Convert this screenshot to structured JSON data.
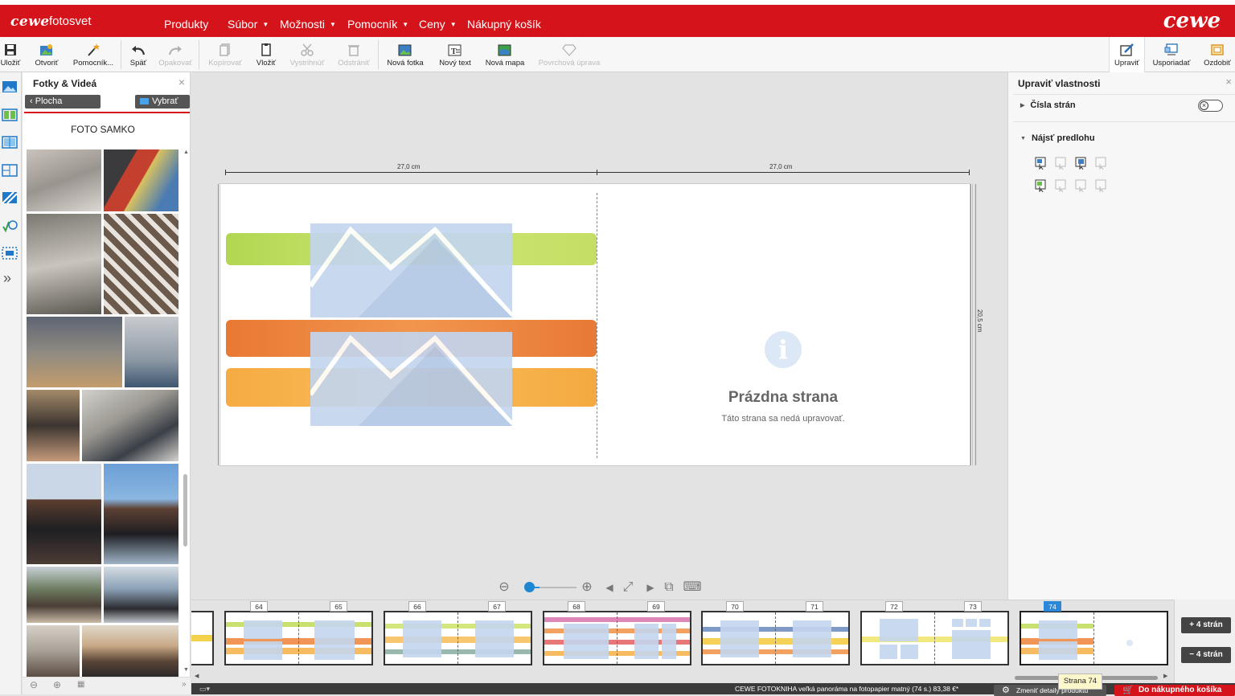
{
  "brand": {
    "logo_left": "cewe",
    "product": "fotosvet",
    "logo_right": "cewe",
    "color": "#d4141a"
  },
  "nav": [
    {
      "label": "Produkty",
      "has_caret": false
    },
    {
      "label": "Súbor",
      "has_caret": true
    },
    {
      "label": "Možnosti",
      "has_caret": true
    },
    {
      "label": "Pomocník",
      "has_caret": true
    },
    {
      "label": "Ceny",
      "has_caret": true
    },
    {
      "label": "Nákupný košík",
      "has_caret": false
    }
  ],
  "toolbar": {
    "save": "Uložiť",
    "open": "Otvoriť",
    "assistant": "Pomocník...",
    "undo": "Späť",
    "redo": "Opakovať",
    "copy": "Kopírovať",
    "paste": "Vložiť",
    "cut": "Vystrihnúť",
    "delete": "Odstrániť",
    "new_photo": "Nová fotka",
    "new_text": "Nový text",
    "new_map": "Nová mapa",
    "surface": "Povrchová úprava",
    "edit": "Upraviť",
    "arrange": "Usporiadať",
    "decorate": "Ozdobiť"
  },
  "photo_panel": {
    "title": "Fotky & Videá",
    "close": "×",
    "back_button": "Plocha",
    "select_button": "Vybrať",
    "folder_name": "FOTO SAMKO"
  },
  "canvas": {
    "left_width_label": "27,0 cm",
    "right_width_label": "27,0 cm",
    "height_label": "20,5 cm",
    "info_glyph": "i",
    "empty_title": "Prázdna strana",
    "empty_subtitle": "Táto strana sa nedá upravovať."
  },
  "right_panel": {
    "title": "Upraviť vlastnosti",
    "close": "×",
    "page_numbers": "Čísla strán",
    "page_numbers_enabled": false,
    "find_template": "Nájsť predlohu"
  },
  "filmstrip": {
    "page_numbers": [
      "64",
      "65",
      "66",
      "67",
      "68",
      "69",
      "70",
      "71",
      "72",
      "73",
      "74"
    ],
    "active_page": "74",
    "add_pages": "+ 4 strán",
    "remove_pages": "− 4 strán",
    "tooltip": "Strana 74"
  },
  "status": {
    "product_text": "CEWE FOTOKNIHA veľká panoráma na fotopapier matný (74 s.) 83,38 €*",
    "details_button": "Zmeniť detaily produktu",
    "cart_button": "Do nákupného košíka"
  }
}
